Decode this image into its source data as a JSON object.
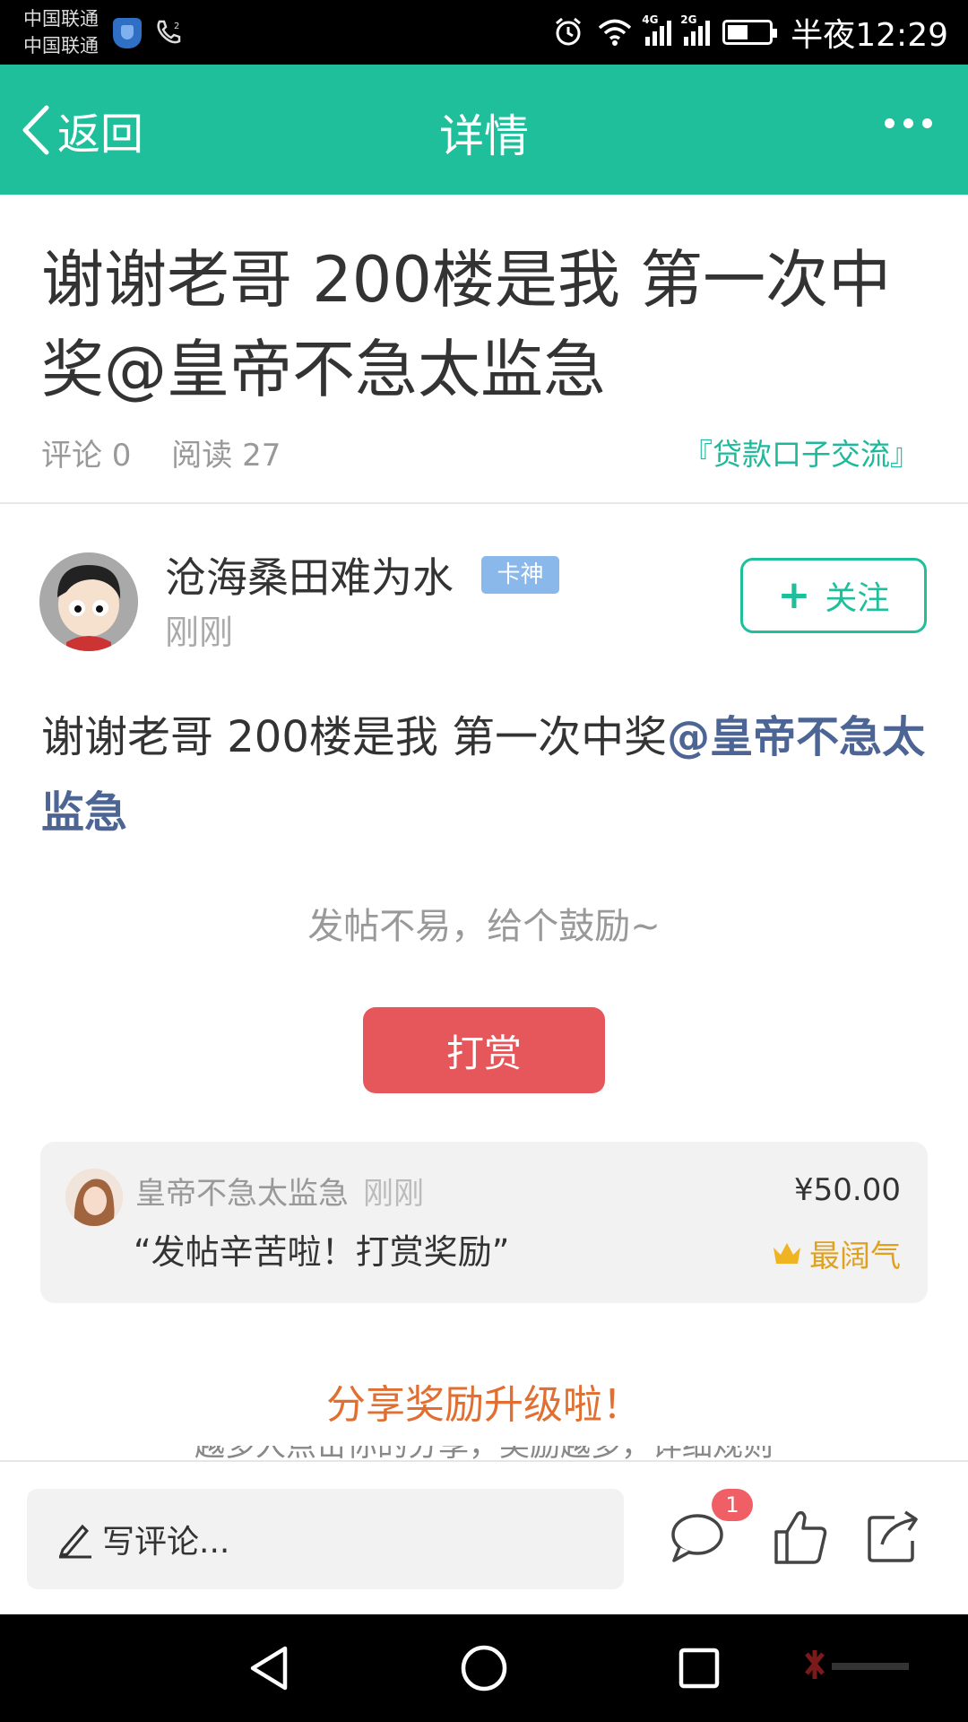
{
  "status_bar": {
    "carrier_1": "中国联通",
    "carrier_2": "中国联通",
    "network_1": "4G",
    "network_2": "2G",
    "time": "半夜12:29"
  },
  "header": {
    "back_label": "返回",
    "title": "详情"
  },
  "post": {
    "title": "谢谢老哥 200楼是我 第一次中奖@皇帝不急太监急",
    "comments": "评论 0",
    "reads": "阅读 27",
    "category": "『贷款口子交流』"
  },
  "author": {
    "name": "沧海桑田难为水",
    "badge": "卡神",
    "time": "刚刚",
    "follow_label": "关注"
  },
  "content": {
    "text": "谢谢老哥 200楼是我  第一次中奖",
    "mention": "@皇帝不急太监急"
  },
  "reward": {
    "prompt": "发帖不易，给个鼓励~",
    "button_label": "打赏",
    "tipper_name": "皇帝不急太监急",
    "tipper_time": "刚刚",
    "message": "“发帖辛苦啦！打赏奖励”",
    "amount": "¥50.00",
    "label": "最阔气"
  },
  "share": {
    "title": "分享奖励升级啦！",
    "subtitle": "越多人点击你的分享，奖励越多，详细规则"
  },
  "bottom_bar": {
    "comment_placeholder": "写评论...",
    "comment_count": "1"
  },
  "colors": {
    "accent": "#1fbf9c",
    "reward_button": "#e5575b",
    "mention": "#4c6594",
    "share_title": "#e06f31",
    "gold": "#e0a120"
  },
  "icons": [
    "back-chevron-icon",
    "more-icon",
    "plus-icon",
    "crown-icon",
    "pencil-icon",
    "comment-icon",
    "like-icon",
    "share-icon",
    "nav-back-icon",
    "nav-home-icon",
    "nav-recents-icon"
  ]
}
